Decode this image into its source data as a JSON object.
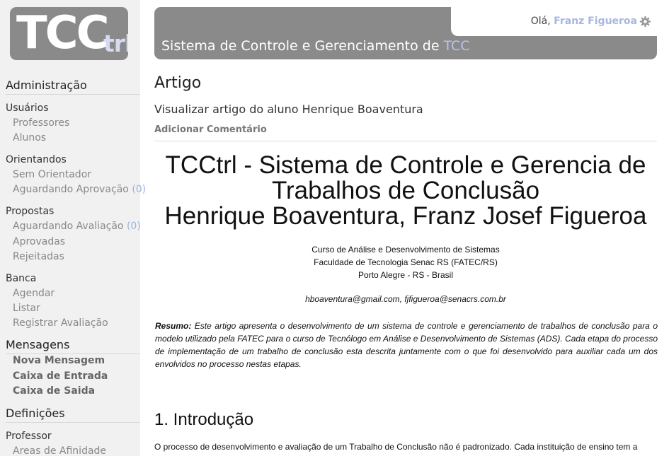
{
  "logo": {
    "main": "TCC",
    "suffix": "trl"
  },
  "sidebar": {
    "admin_title": "Administração",
    "usuarios": {
      "title": "Usuários",
      "items": [
        "Professores",
        "Alunos"
      ]
    },
    "orientandos": {
      "title": "Orientandos",
      "sem_orientador": "Sem Orientador",
      "aguardando_label": "Aguardando Aprovação",
      "aguardando_count": "(0)"
    },
    "propostas": {
      "title": "Propostas",
      "aguardando_label": "Aguardando Avaliação",
      "aguardando_count": "(0)",
      "aprovadas": "Aprovadas",
      "rejeitadas": "Rejeitadas"
    },
    "banca": {
      "title": "Banca",
      "items": [
        "Agendar",
        "Listar",
        "Registrar Avaliação"
      ]
    },
    "mensagens": {
      "title": "Mensagens",
      "items": [
        "Nova Mensagem",
        "Caixa de Entrada",
        "Caixa de Saida"
      ]
    },
    "definicoes": {
      "title": "Definições",
      "professor": "Professor",
      "areas": "Areas de Afinidade"
    }
  },
  "header": {
    "greeting": "Olá,",
    "user_name": "Franz Figueroa",
    "title_prefix": "Sistema de Controle e Gerenciamento de",
    "title_accent": "TCC"
  },
  "main": {
    "title": "Artigo",
    "subtitle": "Visualizar artigo do aluno Henrique Boaventura",
    "add_comment": "Adicionar Comentário"
  },
  "article": {
    "title_line1": "TCCtrl - Sistema de Controle e Gerencia de",
    "title_line2": "Trabalhos de Conclusão",
    "title_line3": "Henrique Boaventura, Franz Josef Figueroa",
    "affiliation": [
      "Curso de Análise e Desenvolvimento de Sistemas",
      "Faculdade de Tecnologia Senac RS (FATEC/RS)",
      "Porto Alegre - RS - Brasil"
    ],
    "emails": "hboaventura@gmail.com,  fjfigueroa@senacrs.com.br",
    "abstract_label": "Resumo:",
    "abstract_text": " Este artigo apresenta  o desenvolvimento de um sistema de controle e gerenciamento de trabalhos de conclusão para o modelo utilizado pela FATEC para o curso de Tecnólogo em Análise e Desenvolvimento de Sistemas (ADS). Cada etapa do processo de implementação de um trabalho de conclusão esta descrita juntamente com o que foi desenvolvido para auxiliar cada um dos envolvidos no processo nestas etapas.",
    "intro_heading": "1. Introdução",
    "intro_text": "O processo de desenvolvimento e avaliação de um Trabalho de Conclusão não é padronizado. Cada instituição de ensino tem a"
  }
}
